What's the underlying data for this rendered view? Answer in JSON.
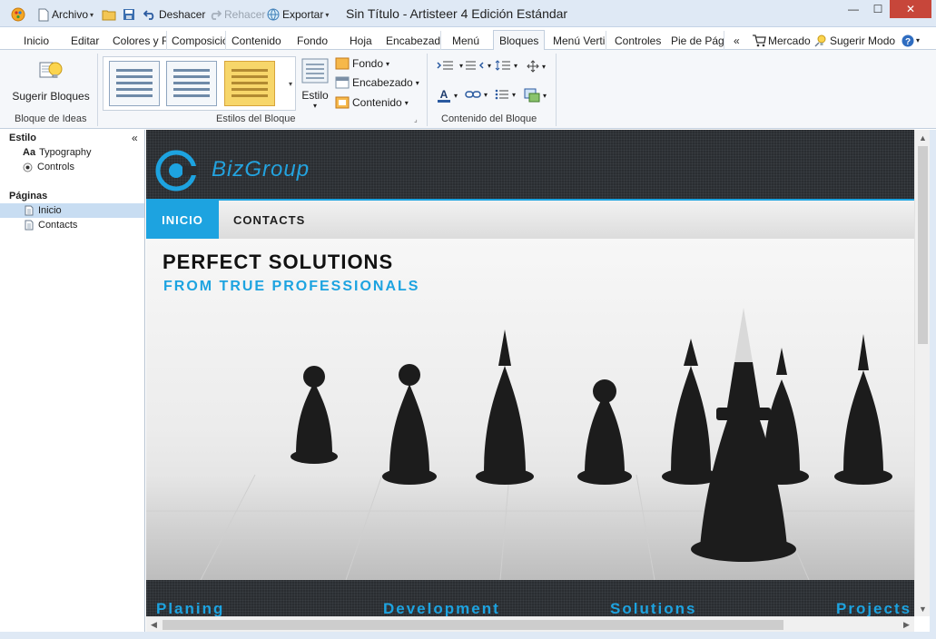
{
  "window": {
    "title": "Sin Título - Artisteer 4 Edición Estándar",
    "minimize_glyph": "—",
    "maximize_glyph": "☐",
    "close_glyph": "✕"
  },
  "quick_access": {
    "archivo": "Archivo",
    "deshacer": "Deshacer",
    "rehacer": "Rehacer",
    "exportar": "Exportar"
  },
  "tabs": [
    "Inicio",
    "Editar",
    "Colores y F",
    "Composició",
    "Contenido",
    "Fondo",
    "Hoja",
    "Encabezad",
    "Menú",
    "Bloques",
    "Menú Verti",
    "Controles",
    "Pie de Pági"
  ],
  "tabs_right": {
    "more_glyph": "«",
    "mercado": "Mercado",
    "sugerir_modo": "Sugerir Modo"
  },
  "ribbon": {
    "ideas_button": "Sugerir Bloques",
    "ideas_group": "Bloque de Ideas",
    "styles_group": "Estilos del Bloque",
    "estilo_button": "Estilo",
    "fondo": "Fondo",
    "encabezado": "Encabezado",
    "contenido": "Contenido",
    "content_group": "Contenido del Bloque"
  },
  "left_panel": {
    "collapse_glyph": "«",
    "estilo_heading": "Estilo",
    "typography_prefix": "Aa",
    "typography": "Typography",
    "controls": "Controls",
    "paginas_heading": "Páginas",
    "pages": [
      "Inicio",
      "Contacts"
    ]
  },
  "site": {
    "logo": "BizGroup",
    "nav": [
      "INICIO",
      "CONTACTS"
    ],
    "hero_title": "PERFECT SOLUTIONS",
    "hero_subtitle": "FROM TRUE PROFESSIONALS",
    "features": [
      "Planing",
      "Development",
      "Solutions",
      "Projects"
    ]
  },
  "colors": {
    "accent": "#1da3e0",
    "header_bg": "#2a2d31",
    "ribbon_bg": "#f5f7fa",
    "titlebar_bg": "#dfe9f5",
    "close_red": "#c7463a"
  },
  "icons": [
    "app-icon",
    "new-document-icon",
    "open-folder-icon",
    "save-icon",
    "undo-icon",
    "redo-icon",
    "export-globe-icon",
    "cart-icon",
    "lightbulb-icon",
    "help-icon",
    "typography-icon",
    "radio-icon",
    "page-icon",
    "chevron-left-icon",
    "chevron-right-icon",
    "chevron-up-icon",
    "chevron-down-icon"
  ]
}
